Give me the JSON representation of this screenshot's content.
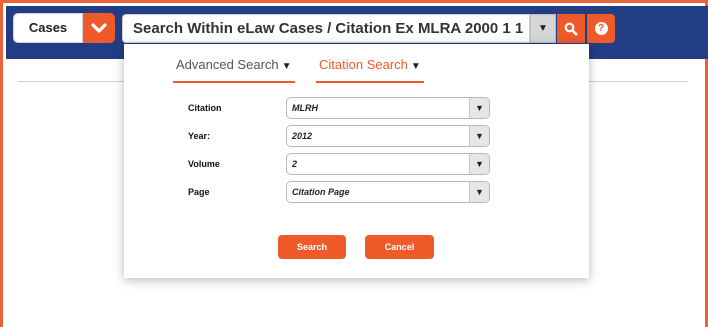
{
  "header": {
    "cases_label": "Cases",
    "search_text": "Search Within eLaw Cases / Citation Ex MLRA 2000 1 1",
    "dropdown_glyph": "▼",
    "help_glyph": "?"
  },
  "tabs": [
    {
      "label": "Advanced Search",
      "caret": "▼",
      "active": false
    },
    {
      "label": "Citation Search",
      "caret": "▼",
      "active": true
    }
  ],
  "form": {
    "fields": [
      {
        "label": "Citation",
        "value": "MLRH"
      },
      {
        "label": "Year:",
        "value": "2012"
      },
      {
        "label": "Volume",
        "value": "2"
      },
      {
        "label": "Page",
        "value": "Citation Page"
      }
    ],
    "arrow_glyph": "▼",
    "search_label": "Search",
    "cancel_label": "Cancel"
  },
  "colors": {
    "accent": "#ef5a2b",
    "header_bg": "#213d84"
  },
  "icons": {
    "cases_toggle": "chevron-down-icon",
    "search": "search-icon",
    "help": "help-icon"
  }
}
